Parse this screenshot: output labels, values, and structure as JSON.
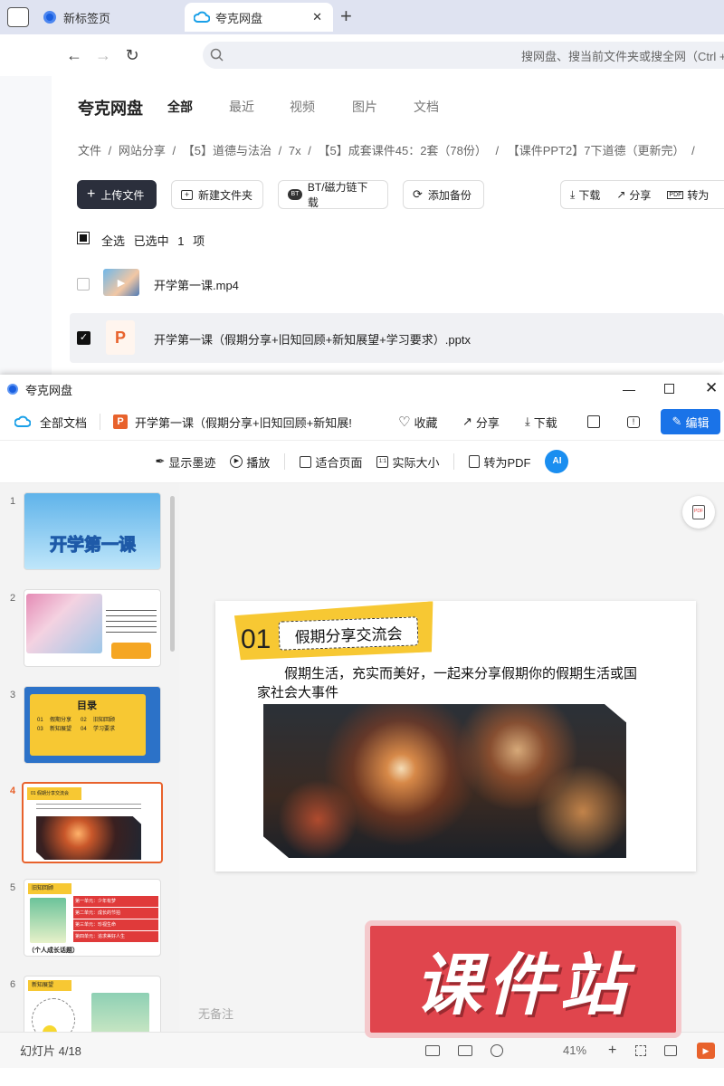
{
  "browser": {
    "tabs": [
      {
        "label": "新标签页"
      },
      {
        "label": "夸克网盘"
      }
    ],
    "new_tab_symbol": "+",
    "close_symbol": "✕",
    "address_placeholder": "搜网盘、搜当前文件夹或搜全网（Ctrl + F"
  },
  "pan": {
    "brand": "夸克网盘",
    "nav": [
      "全部",
      "最近",
      "视频",
      "图片",
      "文档"
    ],
    "breadcrumb": [
      "文件",
      "网站分享",
      "【5】道德与法治",
      "7x",
      "【5】成套课件45：2套（78份）",
      "【课件PPT2】7下道德（更新完）"
    ],
    "breadcrumb_sep": "/",
    "upload_label": "上传文件",
    "new_folder_label": "新建文件夹",
    "bt_label": "BT/磁力链下载",
    "backup_label": "添加备份",
    "download_label": "下载",
    "share_label": "分享",
    "convert_label": "转为",
    "select_all": "全选",
    "selected_text": "已选中",
    "selected_count": "1",
    "selected_unit": "项",
    "files": [
      {
        "name": "开学第一课.mp4",
        "checked": false
      },
      {
        "name": "开学第一课（假期分享+旧知回顾+新知展望+学习要求）.pptx",
        "checked": true
      }
    ]
  },
  "viewer": {
    "window_title": "夸克网盘",
    "all_docs": "全部文档",
    "doc_title": "开学第一课（假期分享+旧知回顾+新知展!",
    "collect": "收藏",
    "share": "分享",
    "download": "下载",
    "edit": "编辑",
    "tools": [
      "显示墨迹",
      "播放",
      "适合页面",
      "实际大小",
      "转为PDF"
    ],
    "thumb_numbers": [
      "1",
      "2",
      "3",
      "4",
      "5",
      "6"
    ],
    "current_slide_index": 4,
    "thumb1_title": "开学第一课",
    "thumb3_title": "目录",
    "thumb3_items": [
      "01",
      "假期分享",
      "02",
      "旧知回顾",
      "03",
      "新知展望",
      "04",
      "学习要求"
    ],
    "thumb4_title": "假期分享交流会",
    "thumb5_units": [
      "第一单元：少年有梦",
      "第二单元：成长的节拍",
      "第三单元：珍视生命",
      "第四单元：追求美好人生"
    ],
    "thumb5_label": "（个人成长话题）",
    "thumb5_tag": "旧知回顾",
    "thumb6_tag": "新知展望",
    "slide": {
      "number": "01",
      "title": "假期分享交流会",
      "body": "假期生活，充实而美好，一起来分享假期你的假期生活或国家社会大事件"
    },
    "notes_placeholder": "无备注",
    "status_text": "幻灯片 4/18",
    "zoom": "41%"
  },
  "watermark": {
    "text": "课件站"
  },
  "colors": {
    "accent": "#1a73e8",
    "upload_btn": "#2b2f3c",
    "ppt_orange": "#e8622c",
    "selected_thumb_border": "#e8622c",
    "slide_yellow": "#f7c833",
    "seal_red": "#e0454d"
  }
}
